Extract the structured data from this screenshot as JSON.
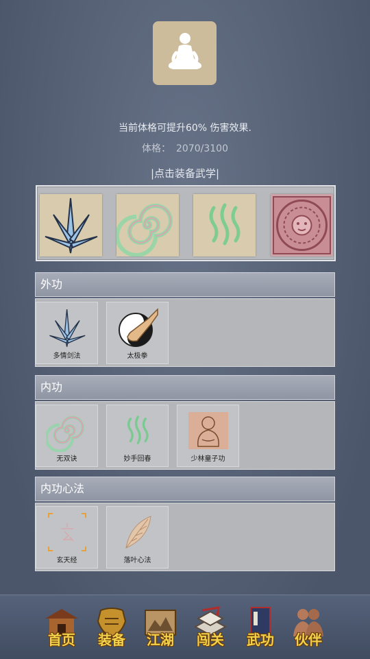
{
  "header": {
    "description": "当前体格可提升60% 伤害效果.",
    "stat_label": "体格：",
    "stat_value": "2070/3100",
    "equip_link": "|点击装备武学|"
  },
  "equipped_slots": [
    {
      "icon": "blue-sword-icon"
    },
    {
      "icon": "spiral-icon"
    },
    {
      "icon": "green-qi-icon"
    },
    {
      "icon": "mandala-icon"
    }
  ],
  "sections": {
    "waigong": {
      "title": "外功",
      "skills": [
        {
          "label": "多情剑法",
          "icon": "blue-sword-icon"
        },
        {
          "label": "太极拳",
          "icon": "taiji-fist-icon"
        }
      ]
    },
    "neigong": {
      "title": "内功",
      "skills": [
        {
          "label": "无双诀",
          "icon": "spiral-icon"
        },
        {
          "label": "妙手回春",
          "icon": "green-qi-icon"
        },
        {
          "label": "少林童子功",
          "icon": "monk-icon"
        }
      ]
    },
    "xinfa": {
      "title": "内功心法",
      "skills": [
        {
          "label": "玄天经",
          "icon": "xuan-rune-icon"
        },
        {
          "label": "落叶心法",
          "icon": "leaf-icon"
        }
      ]
    }
  },
  "nav": [
    {
      "label": "首页",
      "icon": "home-icon"
    },
    {
      "label": "装备",
      "icon": "armor-icon"
    },
    {
      "label": "江湖",
      "icon": "scroll-map-icon"
    },
    {
      "label": "闯关",
      "icon": "book-stack-icon"
    },
    {
      "label": "武功",
      "icon": "manual-book-icon"
    },
    {
      "label": "伙伴",
      "icon": "partners-icon"
    }
  ],
  "colors": {
    "background": "#5e6a80",
    "nav_text": "#f2d24a",
    "panel": "#b4b6b9"
  }
}
